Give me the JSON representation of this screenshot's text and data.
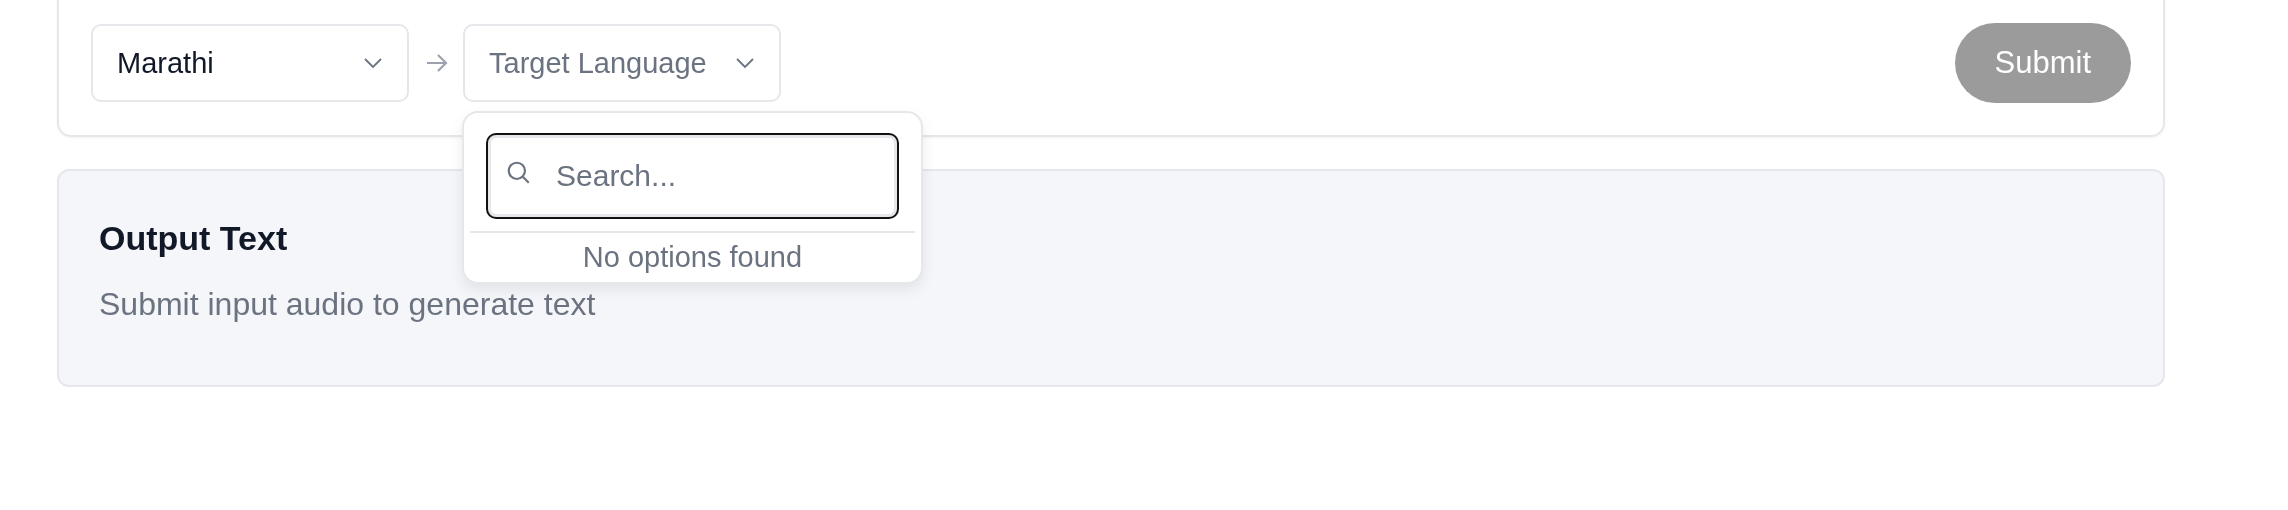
{
  "source_select": {
    "value": "Marathi"
  },
  "target_select": {
    "placeholder": "Target Language",
    "expanded": true
  },
  "dropdown": {
    "search": {
      "placeholder": "Search..."
    },
    "empty_message": "No options found"
  },
  "submit_button": {
    "label": "Submit",
    "disabled": true
  },
  "output": {
    "title": "Output Text",
    "placeholder": "Submit input audio to generate text"
  }
}
